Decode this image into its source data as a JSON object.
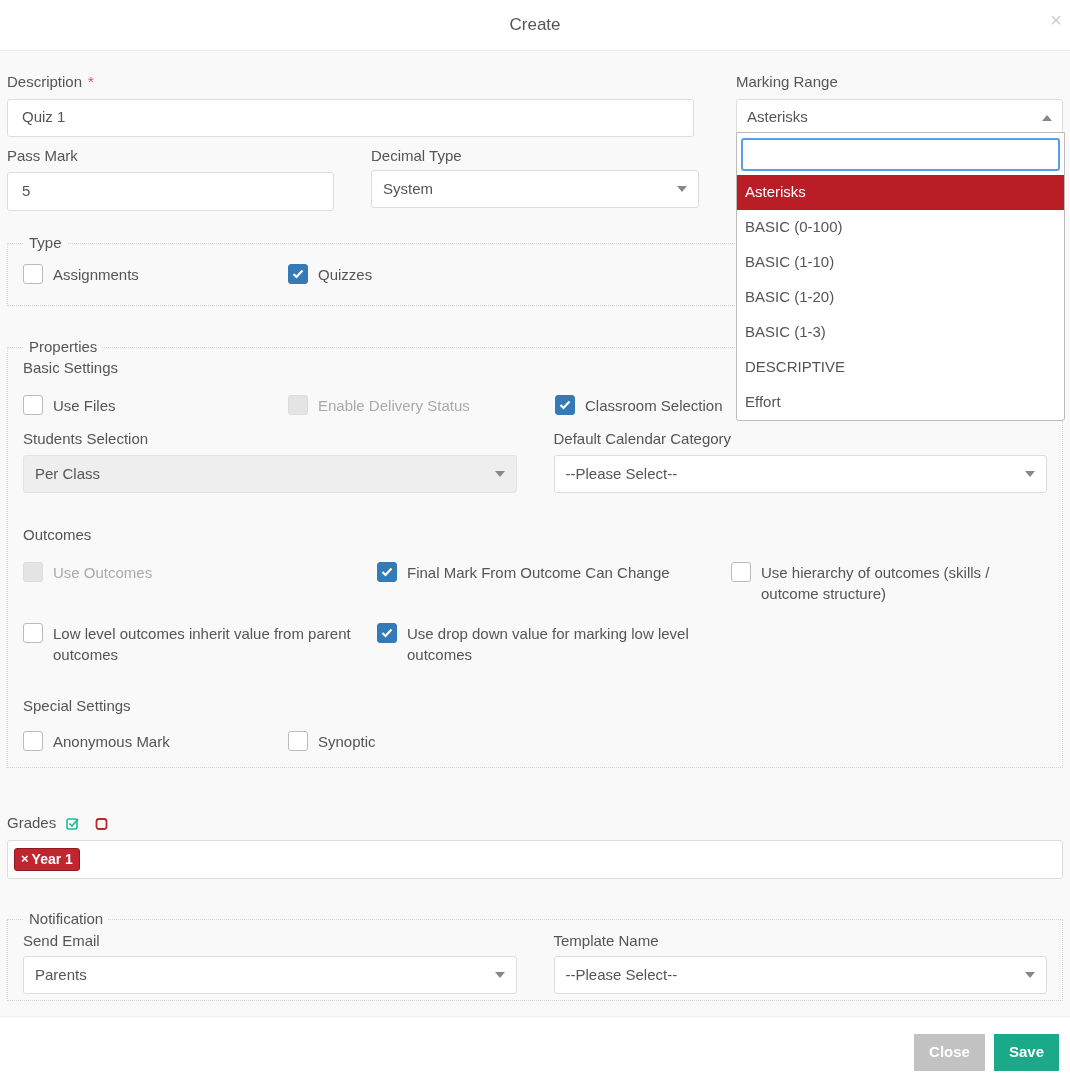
{
  "dialog": {
    "title": "Create",
    "close": "×"
  },
  "description": {
    "label": "Description",
    "required": "*",
    "value": "Quiz 1"
  },
  "marking_range": {
    "label": "Marking Range",
    "value": "Asterisks",
    "expanded": true,
    "options": [
      {
        "label": "Asterisks",
        "selected": true
      },
      {
        "label": "BASIC (0-100)",
        "selected": false
      },
      {
        "label": "BASIC (1-10)",
        "selected": false
      },
      {
        "label": "BASIC (1-20)",
        "selected": false
      },
      {
        "label": "BASIC (1-3)",
        "selected": false
      },
      {
        "label": "DESCRIPTIVE",
        "selected": false
      },
      {
        "label": "Effort",
        "selected": false
      }
    ]
  },
  "pass_mark": {
    "label": "Pass Mark",
    "value": "5"
  },
  "decimal_type": {
    "label": "Decimal Type",
    "value": "System"
  },
  "type": {
    "legend": "Type",
    "options": [
      {
        "label": "Assignments",
        "checked": false,
        "disabled": false
      },
      {
        "label": "Quizzes",
        "checked": true,
        "disabled": false
      }
    ]
  },
  "properties": {
    "legend": "Properties",
    "basic_settings": {
      "heading": "Basic Settings",
      "options": [
        {
          "label": "Use Files",
          "checked": false,
          "disabled": false
        },
        {
          "label": "Enable Delivery Status",
          "checked": false,
          "disabled": true
        },
        {
          "label": "Classroom Selection",
          "checked": true,
          "disabled": false
        }
      ]
    },
    "students_selection": {
      "label": "Students Selection",
      "value": "Per Class",
      "disabled": true
    },
    "default_calendar_category": {
      "label": "Default Calendar Category",
      "value": "--Please Select--",
      "disabled": false
    },
    "outcomes": {
      "heading": "Outcomes",
      "options": [
        {
          "label": "Use Outcomes",
          "checked": false,
          "disabled": true
        },
        {
          "label": "Final Mark From Outcome Can Change",
          "checked": true,
          "disabled": false
        },
        {
          "label": "Use hierarchy of outcomes (skills / outcome structure)",
          "checked": false,
          "disabled": false
        },
        {
          "label": "Low level outcomes inherit value from parent outcomes",
          "checked": false,
          "disabled": false
        },
        {
          "label": "Use drop down value for marking low level outcomes",
          "checked": true,
          "disabled": false
        }
      ]
    },
    "special_settings": {
      "heading": "Special Settings",
      "options": [
        {
          "label": "Anonymous Mark",
          "checked": false,
          "disabled": false
        },
        {
          "label": "Synoptic",
          "checked": false,
          "disabled": false
        }
      ]
    }
  },
  "grades": {
    "label": "Grades",
    "tags": [
      {
        "label": "Year 1",
        "remove": "×"
      }
    ]
  },
  "notification": {
    "legend": "Notification",
    "send_email": {
      "label": "Send Email",
      "value": "Parents",
      "disabled": false
    },
    "template_name": {
      "label": "Template Name",
      "value": "--Please Select--",
      "disabled": false
    }
  },
  "buttons": [
    {
      "label": "Close",
      "kind": "secondary"
    },
    {
      "label": "Save",
      "kind": "primary"
    }
  ]
}
